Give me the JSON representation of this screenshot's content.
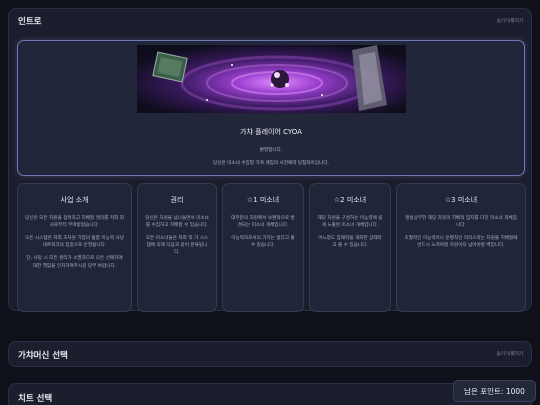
{
  "intro": {
    "title": "인트로",
    "collapse_label": "숨기기/펼치기",
    "hero": {
      "title": "가챠 플레이어 CYOA",
      "line1": "환영합니다.",
      "line2": "당신은 미소녀 수집형 가챠 게임의 사전예약 당첨자이십니다."
    },
    "cards": [
      {
        "title": "사업 소개",
        "paragraphs": [
          "당신은 모든 차원을 점목하고 지배할 권리를 저희 회사로부터 부여받았습니다.",
          "오든 시스템은 저희 초차원 기업의 통합 이능력 사냥 네트워크의 집중으로 운영됩니다.",
          "단, 사망 시 모든 권리가 소멸하므로 오든 선택지에 대한 책임을 인지하여주시길 당부 바랍니다."
        ]
      },
      {
        "title": "권리",
        "paragraphs": [
          "당신은 차원을 넘나들면서 미소녀를 수집하고 지배할 수 있습니다.",
          "모든 미소녀들은 저희 쪽 가 시스템에 의해 다음과 같이 분류됩니다."
        ]
      },
      {
        "title": "☆1 미소녀",
        "paragraphs": [
          "대부분의 차원에서 보편적으로 발견되는 미소녀 개체입니다.",
          "이능력자로서의 가치는 없다고 볼 수 있습니다."
        ]
      },
      {
        "title": "☆2 미소녀",
        "paragraphs": [
          "해당 차원을 구성하는 이능력에 쉽게 노출된 미소녀 개체입니다.",
          "어느정도 잠재력을 개화한 상태라고 볼 수 있습니다."
        ]
      },
      {
        "title": "☆3 미소녀",
        "paragraphs": [
          "명실상부한 해당 차원의 지배적 입지를 다진 미소녀 개체입니다.",
          "초월적인 이능력이나 운명적인 카리스마는 차원을 지배할때 반드시 노려야할 차원이자 넘어야할 벽입니다."
        ]
      }
    ]
  },
  "gacha_section": {
    "title": "가챠머신 선택",
    "collapse_label": "숨기기/펼치기"
  },
  "cheat_section": {
    "title": "치트 선택"
  },
  "points": {
    "label": "남은 포인트: 1000"
  },
  "colors": {
    "background": "#0f111a",
    "panel": "#1b1e2c",
    "card": "#21253a",
    "hero_border": "#6f79b6"
  }
}
